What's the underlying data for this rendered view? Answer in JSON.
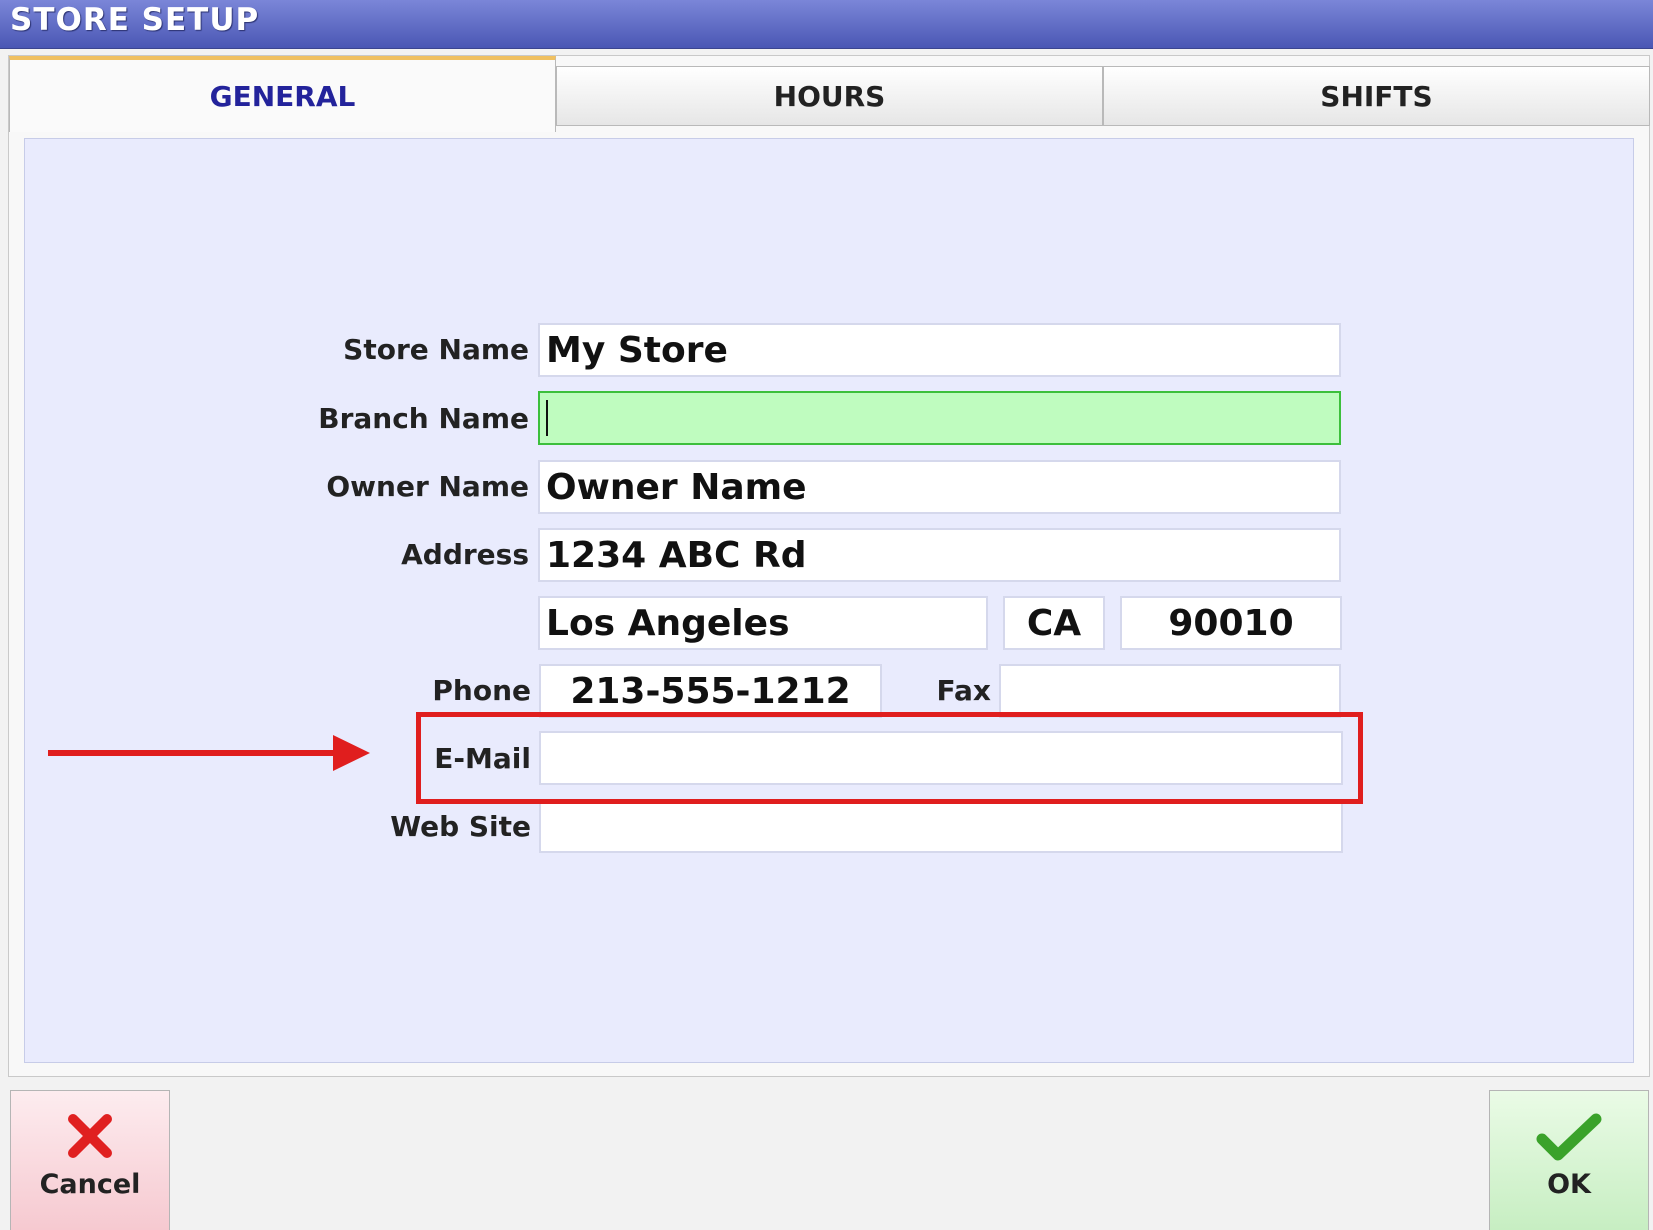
{
  "window": {
    "title": "STORE SETUP"
  },
  "tabs": [
    {
      "label": "GENERAL",
      "active": true
    },
    {
      "label": "HOURS",
      "active": false
    },
    {
      "label": "SHIFTS",
      "active": false
    }
  ],
  "form": {
    "store_name": {
      "label": "Store Name",
      "value": "My Store"
    },
    "branch_name": {
      "label": "Branch Name",
      "value": ""
    },
    "owner_name": {
      "label": "Owner Name",
      "value": "Owner Name"
    },
    "address": {
      "label": "Address",
      "value": "1234 ABC Rd"
    },
    "city": {
      "value": "Los Angeles"
    },
    "state": {
      "value": "CA"
    },
    "zip": {
      "value": "90010"
    },
    "phone": {
      "label": "Phone",
      "value": "213-555-1212"
    },
    "fax": {
      "label": "Fax",
      "value": ""
    },
    "email": {
      "label": "E-Mail",
      "value": ""
    },
    "website": {
      "label": "Web Site",
      "value": ""
    }
  },
  "buttons": {
    "cancel": {
      "label": "Cancel",
      "icon": "red-x-icon"
    },
    "ok": {
      "label": "OK",
      "icon": "green-check-icon"
    }
  },
  "colors": {
    "active_field": "#bffcbf",
    "highlight_box": "#e01e1e",
    "active_tab_text": "#23239b"
  }
}
